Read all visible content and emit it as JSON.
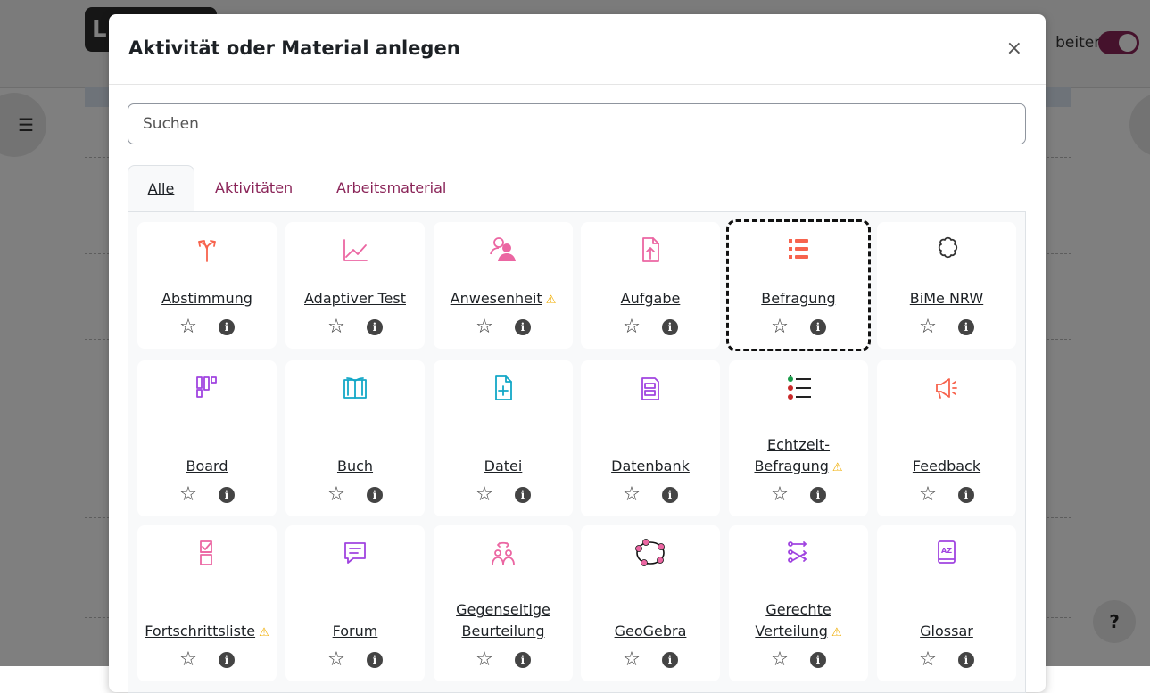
{
  "background": {
    "edit_text": "beiten",
    "logo_text": "L",
    "help_text": "?"
  },
  "modal": {
    "title": "Aktivität oder Material anlegen",
    "close_symbol": "×",
    "search_placeholder": "Suchen",
    "tabs": [
      {
        "label": "Alle",
        "active": true
      },
      {
        "label": "Aktivitäten",
        "active": false
      },
      {
        "label": "Arbeitsmaterial",
        "active": false
      }
    ],
    "modules": [
      {
        "line1": "Abstimmung",
        "line2": "",
        "warning": false,
        "icon": "choice-icon",
        "color": "#f7634d"
      },
      {
        "line1": "Adaptiver Test",
        "line2": "",
        "warning": false,
        "icon": "chart-line-icon",
        "color": "#eb66a2"
      },
      {
        "line1": "Anwesenheit",
        "line2": "",
        "warning": true,
        "icon": "attendance-icon",
        "color": "#eb66a2"
      },
      {
        "line1": "Aufgabe",
        "line2": "",
        "warning": false,
        "icon": "assignment-icon",
        "color": "#eb66a2"
      },
      {
        "line1": "Befragung",
        "line2": "",
        "warning": false,
        "icon": "questionnaire-icon",
        "color": "#f7634d"
      },
      {
        "line1": "BiMe NRW",
        "line2": "",
        "warning": false,
        "icon": "puzzle-icon",
        "color": "#333333"
      },
      {
        "line1": "Board",
        "line2": "",
        "warning": false,
        "icon": "board-icon",
        "color": "#a044e0"
      },
      {
        "line1": "Buch",
        "line2": "",
        "warning": false,
        "icon": "book-icon",
        "color": "#13a7c7"
      },
      {
        "line1": "Datei",
        "line2": "",
        "warning": false,
        "icon": "file-icon",
        "color": "#13a7c7"
      },
      {
        "line1": "Datenbank",
        "line2": "",
        "warning": false,
        "icon": "database-icon",
        "color": "#a044e0"
      },
      {
        "line1": "Echtzeit-",
        "line2": "Befragung",
        "warning": true,
        "icon": "live-quiz-icon",
        "color": "#333333"
      },
      {
        "line1": "Feedback",
        "line2": "",
        "warning": false,
        "icon": "megaphone-icon",
        "color": "#f7634d"
      },
      {
        "line1": "Fortschrittsliste",
        "line2": "",
        "warning": true,
        "icon": "checklist-icon",
        "color": "#eb66a2"
      },
      {
        "line1": "Forum",
        "line2": "",
        "warning": false,
        "icon": "forum-icon",
        "color": "#a044e0"
      },
      {
        "line1": "Gegenseitige",
        "line2": "Beurteilung",
        "warning": false,
        "icon": "workshop-icon",
        "color": "#eb66a2"
      },
      {
        "line1": "GeoGebra",
        "line2": "",
        "warning": false,
        "icon": "geogebra-icon",
        "color": "#eb66a2"
      },
      {
        "line1": "Gerechte",
        "line2": "Verteilung",
        "warning": true,
        "icon": "ratingallocate-icon",
        "color": "#a044e0"
      },
      {
        "line1": "Glossar",
        "line2": "",
        "warning": false,
        "icon": "glossary-icon",
        "color": "#a044e0"
      }
    ],
    "star_symbol": "☆",
    "info_symbol": "i",
    "warning_symbol": "⚠"
  }
}
